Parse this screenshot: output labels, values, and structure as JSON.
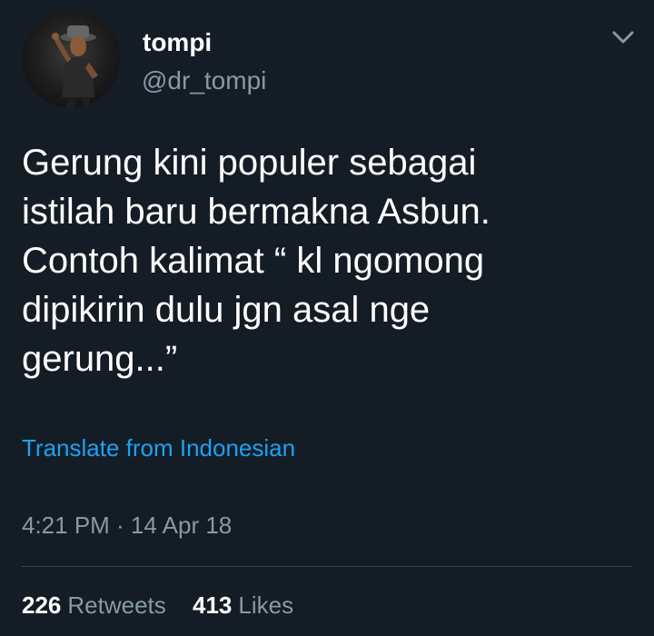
{
  "user": {
    "display_name": "tompi",
    "handle": "@dr_tompi"
  },
  "menu": {
    "icon": "chevron-down-icon"
  },
  "tweet": {
    "text": "Gerung kini populer sebagai\nistilah baru bermakna Asbun.\nContoh kalimat “ kl ngomong\ndipikirin dulu jgn asal nge\ngerung...”",
    "translate_label": "Translate from Indonesian",
    "timestamp": "4:21 PM · 14 Apr 18"
  },
  "stats": {
    "retweets_count": "226",
    "retweets_label": "Retweets",
    "likes_count": "413",
    "likes_label": "Likes"
  },
  "colors": {
    "background": "#141d26",
    "link": "#1da1f2",
    "secondary_text": "#8899a6",
    "divider": "#38444d"
  }
}
